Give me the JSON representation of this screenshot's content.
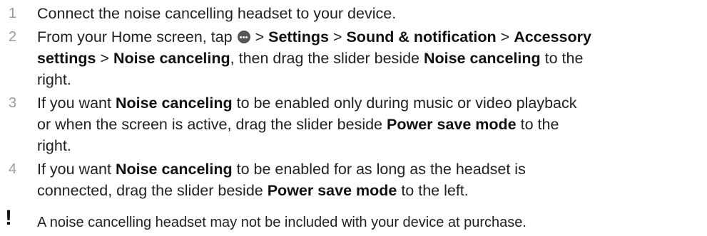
{
  "steps": [
    {
      "num": "1",
      "lines": [
        [
          {
            "t": "Connect the noise cancelling headset to your device."
          }
        ]
      ]
    },
    {
      "num": "2",
      "lines": [
        [
          {
            "t": "From your Home screen, tap "
          },
          {
            "icon": "apps-icon"
          },
          {
            "t": " > "
          },
          {
            "b": "Settings"
          },
          {
            "t": " > "
          },
          {
            "b": "Sound & notification"
          },
          {
            "t": " > "
          },
          {
            "b": "Accessory"
          }
        ],
        [
          {
            "b": "settings"
          },
          {
            "t": " > "
          },
          {
            "b": "Noise canceling"
          },
          {
            "t": ", then drag the slider beside "
          },
          {
            "b": "Noise canceling"
          },
          {
            "t": " to the"
          }
        ],
        [
          {
            "t": "right."
          }
        ]
      ]
    },
    {
      "num": "3",
      "lines": [
        [
          {
            "t": "If you want "
          },
          {
            "b": "Noise canceling"
          },
          {
            "t": " to be enabled only during music or video playback"
          }
        ],
        [
          {
            "t": "or when the screen is active, drag the slider beside "
          },
          {
            "b": "Power save mode"
          },
          {
            "t": " to the"
          }
        ],
        [
          {
            "t": "right."
          }
        ]
      ]
    },
    {
      "num": "4",
      "lines": [
        [
          {
            "t": "If you want "
          },
          {
            "b": "Noise canceling"
          },
          {
            "t": " to be enabled for as long as the headset is"
          }
        ],
        [
          {
            "t": "connected, drag the slider beside "
          },
          {
            "b": "Power save mode"
          },
          {
            "t": " to the left."
          }
        ]
      ]
    }
  ],
  "note": {
    "icon": "exclamation-icon",
    "symbol": "!",
    "text": "A noise cancelling headset may not be included with your device at purchase."
  }
}
